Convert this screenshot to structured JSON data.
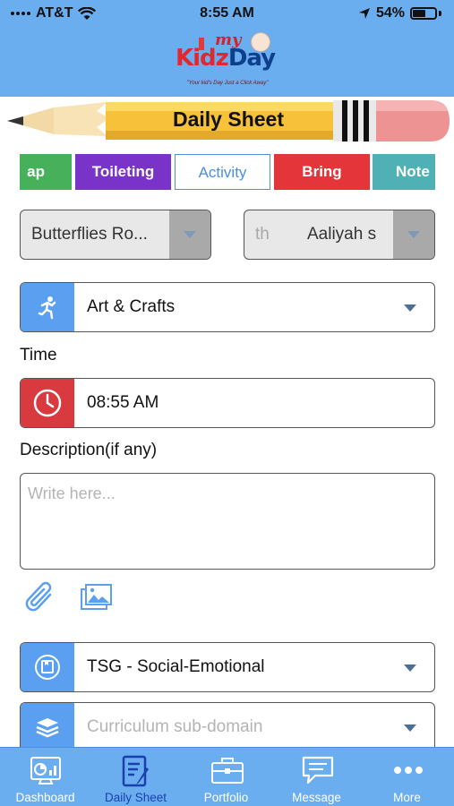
{
  "status_bar": {
    "carrier": "AT&T",
    "time": "8:55 AM",
    "battery": "54%"
  },
  "logo": {
    "my": "my",
    "kidz": "Kidz",
    "day": "Day",
    "tagline": "\"Your kid's Day Just a Click Away\""
  },
  "banner": {
    "title": "Daily Sheet"
  },
  "tabs": [
    {
      "label": "ap",
      "color": "#46b15a"
    },
    {
      "label": "Toileting",
      "color": "#7a33c8"
    },
    {
      "label": "Activity",
      "color": "#4a8fe0",
      "selected": true
    },
    {
      "label": "Bring",
      "color": "#e3353a"
    },
    {
      "label": "Note",
      "color": "#4fb1b6"
    }
  ],
  "room_select": {
    "value": "Butterflies Ro..."
  },
  "child_select": {
    "prefix": "th",
    "value": "Aaliyah s"
  },
  "activity_select": {
    "value": "Art & Crafts",
    "icon": "running-person-icon"
  },
  "time": {
    "label": "Time",
    "value": "08:55 AM",
    "icon": "clock-icon"
  },
  "description": {
    "label": "Description(if any)",
    "placeholder": "Write here..."
  },
  "attachments": {
    "icons": [
      "paperclip-icon",
      "gallery-icon"
    ]
  },
  "domain_select": {
    "value": "TSG - Social-Emotional",
    "icon": "book-icon"
  },
  "subdomain_select": {
    "placeholder": "Curriculum sub-domain",
    "icon": "books-stack-icon"
  },
  "tabbar": [
    {
      "label": "Dashboard",
      "icon": "dashboard-icon"
    },
    {
      "label": "Daily Sheet",
      "icon": "daily-sheet-icon",
      "active": true
    },
    {
      "label": "Portfolio",
      "icon": "briefcase-icon"
    },
    {
      "label": "Message",
      "icon": "chat-icon"
    },
    {
      "label": "More",
      "icon": "more-dots-icon"
    }
  ],
  "colors": {
    "header": "#6aaef0",
    "accent": "#4a8fe0",
    "active_tab_text": "#1c3fae"
  }
}
